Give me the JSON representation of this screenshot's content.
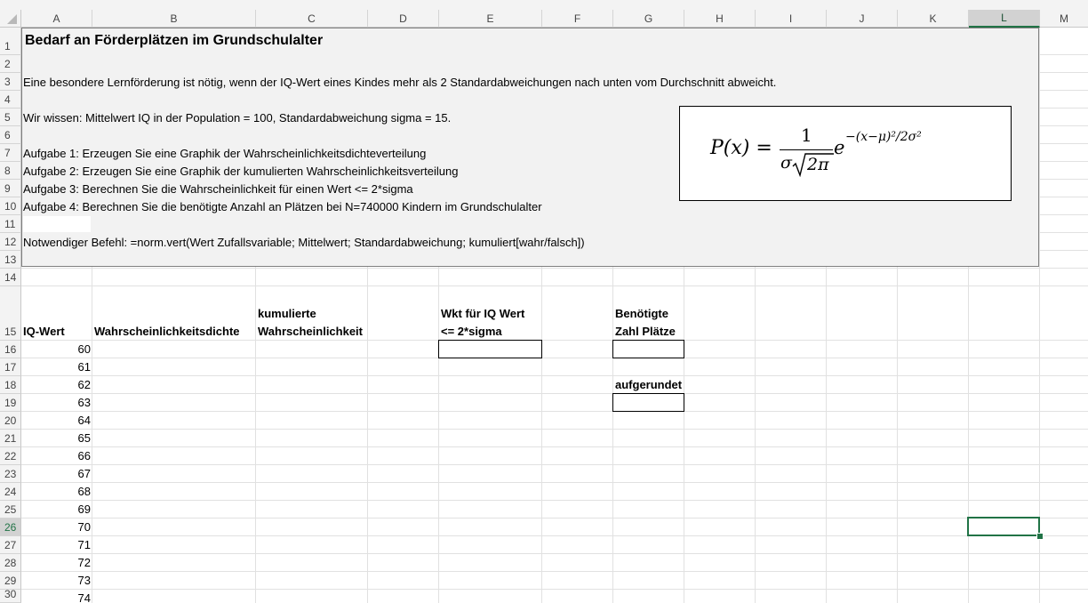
{
  "columns": [
    "A",
    "B",
    "C",
    "D",
    "E",
    "F",
    "G",
    "H",
    "I",
    "J",
    "K",
    "L",
    "M"
  ],
  "rows": [
    "1",
    "2",
    "3",
    "4",
    "5",
    "6",
    "7",
    "8",
    "9",
    "10",
    "11",
    "12",
    "13",
    "14",
    "15",
    "16",
    "17",
    "18",
    "19",
    "20",
    "21",
    "22",
    "23",
    "24",
    "25",
    "26",
    "27",
    "28",
    "29",
    "30"
  ],
  "info_box": {
    "title": "Bedarf an Förderplätzen im Grundschulalter",
    "line3": "Eine besondere Lernförderung ist nötig, wenn der IQ-Wert eines Kindes mehr als 2 Standardabweichungen nach unten vom Durchschnitt abweicht.",
    "line5": "Wir wissen: Mittelwert IQ in der Population = 100, Standardabweichung sigma = 15.",
    "line7": "Aufgabe 1: Erzeugen Sie eine Graphik der Wahrscheinlichkeitsdichteverteilung",
    "line8": "Aufgabe 2: Erzeugen Sie eine Graphik der kumulierten Wahrscheinlichkeitsverteilung",
    "line9": "Aufgabe 3: Berechnen Sie die Wahrscheinlichkeit für einen Wert <= 2*sigma",
    "line10": "Aufgabe 4: Berechnen Sie die benötigte Anzahl an Plätzen bei N=740000 Kindern im Grundschulalter",
    "line12": "Notwendiger Befehl: =norm.vert(Wert Zufallsvariable; Mittelwert; Standardabweichung; kumuliert[wahr/falsch])"
  },
  "formula": {
    "lhs": "P(x) =",
    "numerator": "1",
    "denominator_sigma": "σ",
    "denominator_root": "2π",
    "base": "e",
    "exponent": "−(x−μ)²/2σ²"
  },
  "headers": {
    "iq_wert": "IQ-Wert",
    "dichte": "Wahrscheinlichkeitsdichte",
    "kumuliert_1": "kumulierte",
    "kumuliert_2": "Wahrscheinlichkeit",
    "wkt_1": "Wkt für IQ Wert",
    "wkt_2": "<= 2*sigma",
    "plaetze_1": "Benötigte",
    "plaetze_2": "Zahl Plätze",
    "aufgerundet": "aufgerundet"
  },
  "iq_values": [
    "60",
    "61",
    "62",
    "63",
    "64",
    "65",
    "66",
    "67",
    "68",
    "69",
    "70",
    "71",
    "72",
    "73",
    "74"
  ],
  "selected_cell": "L26",
  "colors": {
    "accent": "#217346",
    "box_fill": "#f2f2f2"
  }
}
